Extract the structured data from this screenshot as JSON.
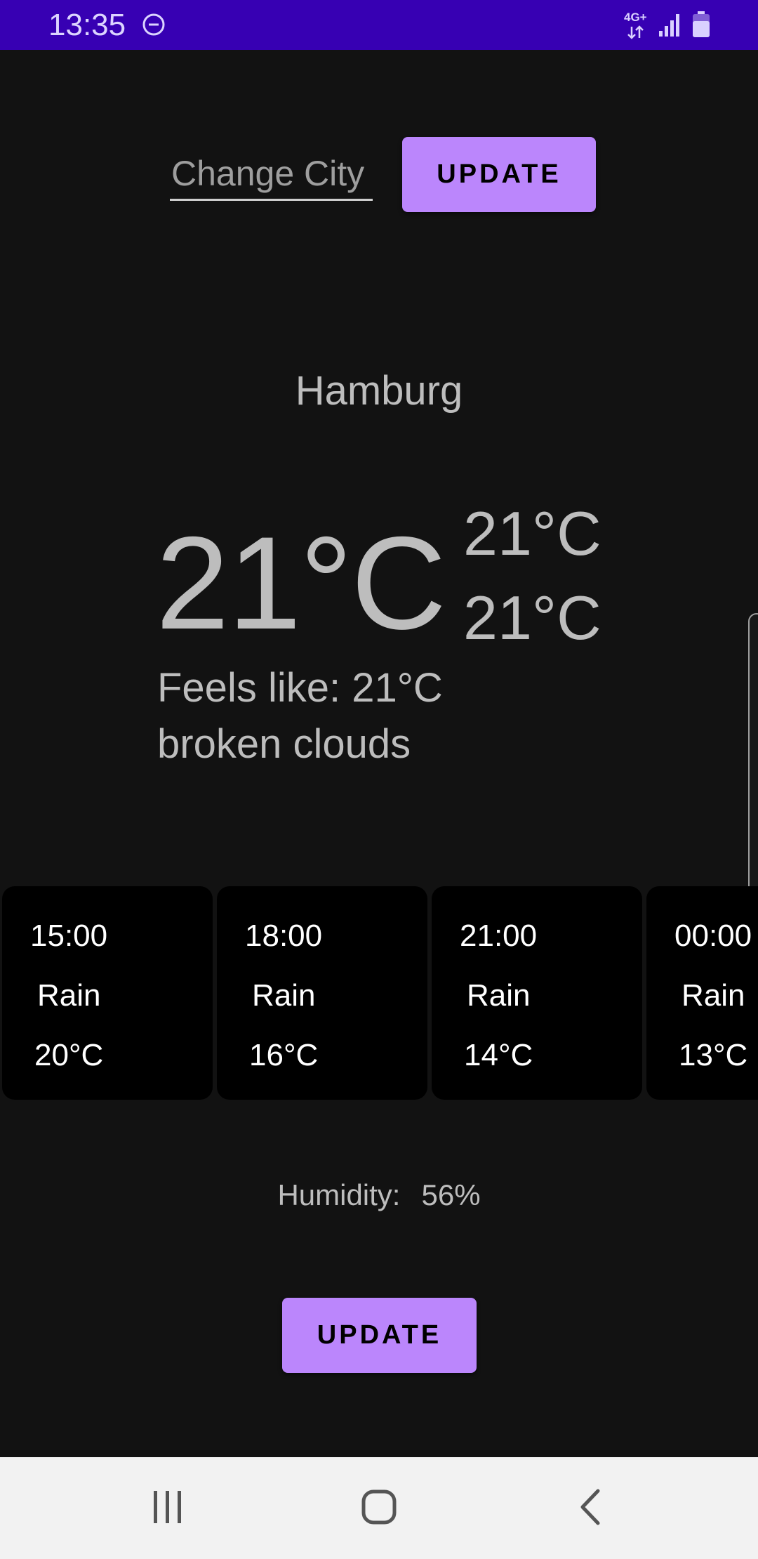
{
  "status_bar": {
    "time": "13:35",
    "network_label": "4G+",
    "icons": [
      "do-not-disturb-icon",
      "network-arrows-icon",
      "signal-icon",
      "battery-icon"
    ],
    "background_color": "#3700b3"
  },
  "search": {
    "placeholder": "Change City",
    "value": "",
    "button_label": "UPDATE"
  },
  "weather": {
    "city": "Hamburg",
    "temperature": "21°C",
    "temp_max": "21°C",
    "temp_min": "21°C",
    "feels_like": "Feels like: 21°C",
    "description": "broken clouds"
  },
  "forecast": [
    {
      "time": "15:00",
      "condition": "Rain",
      "temp": "20°C"
    },
    {
      "time": "18:00",
      "condition": "Rain",
      "temp": "16°C"
    },
    {
      "time": "21:00",
      "condition": "Rain",
      "temp": "14°C"
    },
    {
      "time": "00:00",
      "condition": "Rain",
      "temp": "13°C"
    }
  ],
  "humidity": {
    "label": "Humidity:",
    "value": "56%"
  },
  "bottom": {
    "button_label": "UPDATE"
  },
  "nav_bar": {
    "icons": [
      "recent-apps-icon",
      "home-icon",
      "back-icon"
    ]
  },
  "colors": {
    "accent": "#bb86fc",
    "background": "#121212",
    "card": "#000000",
    "text": "#bdbdbd"
  }
}
